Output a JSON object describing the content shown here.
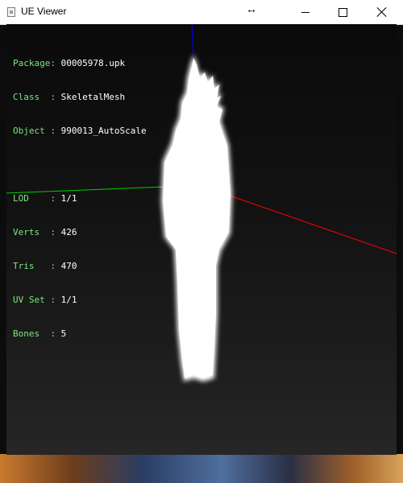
{
  "window": {
    "title": "UE Viewer",
    "resize_cursor_glyph": "↔"
  },
  "info": {
    "package": {
      "label": "Package",
      "value": "00005978.upk"
    },
    "class": {
      "label": "Class  ",
      "value": "SkeletalMesh"
    },
    "object": {
      "label": "Object ",
      "value": "990013_AutoScale"
    },
    "lod": {
      "label": "LOD    ",
      "value": "1/1"
    },
    "verts": {
      "label": "Verts  ",
      "value": "426"
    },
    "tris": {
      "label": "Tris   ",
      "value": "470"
    },
    "uvset": {
      "label": "UV Set ",
      "value": "1/1"
    },
    "bones": {
      "label": "Bones  ",
      "value": "5"
    }
  },
  "colors": {
    "label_green": "#7fe57f",
    "value_white": "#ffffff",
    "axis_x": "#ff0000",
    "axis_y": "#00cc00",
    "axis_z": "#0000ff",
    "mesh": "#ffffff"
  },
  "icons": {
    "app": "app-window-icon",
    "minimize": "minimize-icon",
    "maximize": "maximize-icon",
    "close": "close-icon"
  }
}
